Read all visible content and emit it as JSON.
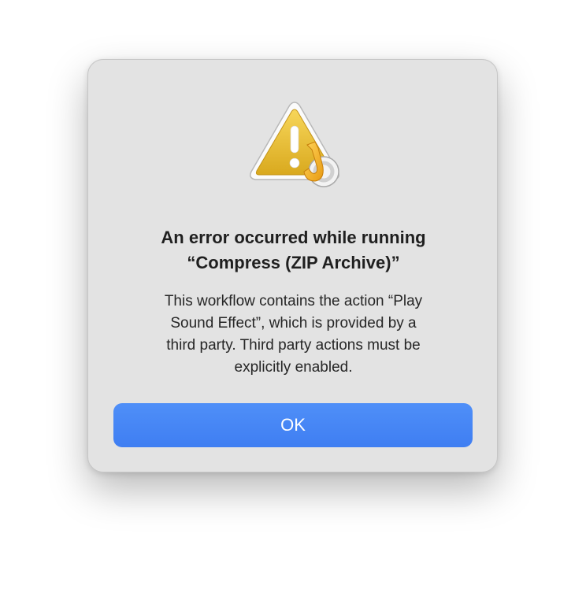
{
  "dialog": {
    "icon": "warning-triangle-automator-icon",
    "title_lines": [
      "An error occurred while running",
      "“Compress (ZIP Archive)”"
    ],
    "message_lines": [
      "This workflow contains the action “Play",
      "Sound Effect”, which is provided by a",
      "third party. Third party actions must be",
      "explicitly enabled."
    ],
    "ok_label": "OK"
  },
  "colors": {
    "dialog_background": "#e3e3e3",
    "button_blue": "#4485f4",
    "warning_yellow": "#f2c73a"
  }
}
